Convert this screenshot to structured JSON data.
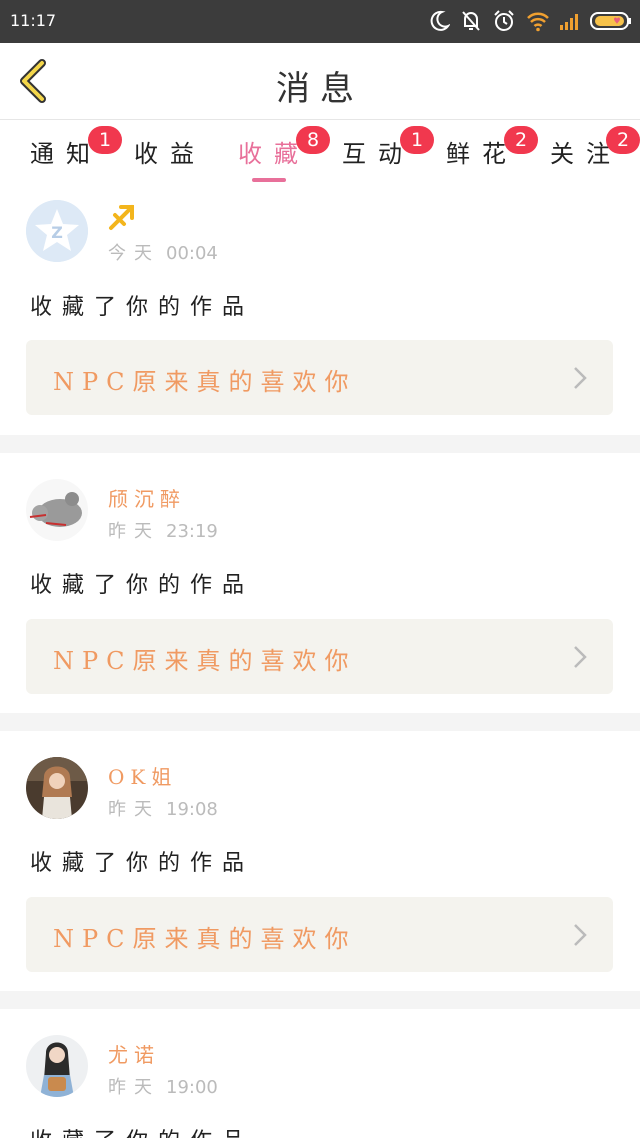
{
  "status_bar": {
    "time": "11:17",
    "icons": [
      "moon-icon",
      "bell-muted-icon",
      "alarm-icon",
      "wifi-icon",
      "signal-icon",
      "battery-icon"
    ]
  },
  "header": {
    "back_icon": "chevron-left-icon",
    "title": "消息"
  },
  "tabs": [
    {
      "label": "通知",
      "badge": "1",
      "active": false
    },
    {
      "label": "收益",
      "badge": "",
      "active": false
    },
    {
      "label": "收藏",
      "badge": "8",
      "active": true
    },
    {
      "label": "互动",
      "badge": "1",
      "active": false
    },
    {
      "label": "鲜花",
      "badge": "2",
      "active": false
    },
    {
      "label": "关注",
      "badge": "2",
      "active": false
    }
  ],
  "colors": {
    "accent": "#e8709a",
    "badge": "#f1384e",
    "name": "#f09a62",
    "card_bg": "#f4f3ee"
  },
  "messages": [
    {
      "user": "",
      "user_icon": "sagittarius-icon",
      "day": "今天",
      "time": "00:04",
      "action": "收藏了你的作品",
      "work_title": "NPC原来真的喜欢你"
    },
    {
      "user": "颀沉醉",
      "day": "昨天",
      "time": "23:19",
      "action": "收藏了你的作品",
      "work_title": "NPC原来真的喜欢你"
    },
    {
      "user": "OK姐",
      "day": "昨天",
      "time": "19:08",
      "action": "收藏了你的作品",
      "work_title": "NPC原来真的喜欢你"
    },
    {
      "user": "尤诺",
      "day": "昨天",
      "time": "19:00",
      "action": "收藏了你的作品",
      "work_title": ""
    }
  ]
}
